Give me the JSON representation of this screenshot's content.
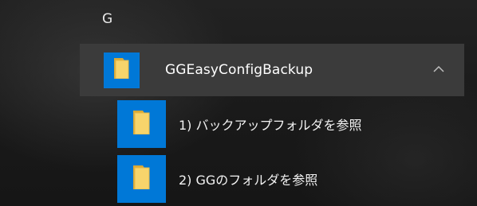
{
  "start_menu": {
    "letter_header": "G",
    "group": {
      "label": "GGEasyConfigBackup",
      "icon": "folder-icon",
      "expand_icon": "chevron-up-icon",
      "tile_color": "#0078d7",
      "row_color": "#3b3b3b"
    },
    "items": [
      {
        "label": "1) バックアップフォルダを参照",
        "icon": "folder-icon"
      },
      {
        "label": "2) GGのフォルダを参照",
        "icon": "folder-icon"
      }
    ]
  }
}
